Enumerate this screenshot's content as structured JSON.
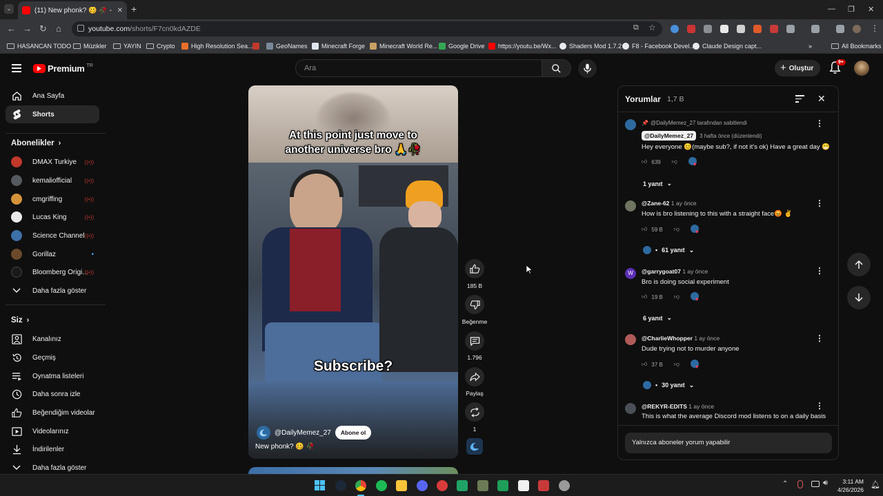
{
  "browser": {
    "tab_title": "(11) New phonk? 🥴 🥀 - YouTube",
    "url_host": "youtube.com",
    "url_path": "/shorts/F7cn0kdAZDE",
    "bookmarks": [
      "HASANCAN TODO",
      "Müzikler",
      "YAYIN",
      "Crypto",
      "High Resolution Sea...",
      "GeoNames",
      "Minecraft Forge",
      "Minecraft World Re...",
      "Google Drive",
      "https://youtu.be/Wx...",
      "Shaders Mod 1.7.2",
      "F8 - Facebook Devel...",
      "Claude Design capt..."
    ],
    "all_bookmarks": "All Bookmarks"
  },
  "header": {
    "logo": "Premium",
    "region": "TR",
    "search_placeholder": "Ara",
    "create_label": "Oluştur",
    "notif_badge": "9+"
  },
  "sidebar": {
    "main": [
      {
        "label": "Ana Sayfa",
        "icon": "home-icon"
      },
      {
        "label": "Shorts",
        "icon": "shorts-icon"
      }
    ],
    "subs_heading": "Abonelikler",
    "subs": [
      {
        "label": "DMAX Turkiye",
        "color": "#c0392b"
      },
      {
        "label": "kemaliofficial",
        "color": "#555a60"
      },
      {
        "label": "cmgriffing",
        "color": "#d4933a"
      },
      {
        "label": "Lucas King",
        "color": "#e9e9e9"
      },
      {
        "label": "Science Channel",
        "color": "#3d6fa8"
      },
      {
        "label": "Gorillaz",
        "color": "#6b4a2b"
      },
      {
        "label": "Bloomberg Origi...",
        "color": "#1a1a1a"
      }
    ],
    "subs_more": "Daha fazla göster",
    "you_heading": "Siz",
    "you": [
      {
        "label": "Kanalınız",
        "icon": "channel-icon"
      },
      {
        "label": "Geçmiş",
        "icon": "history-icon"
      },
      {
        "label": "Oynatma listeleri",
        "icon": "playlists-icon"
      },
      {
        "label": "Daha sonra izle",
        "icon": "watch-later-icon"
      },
      {
        "label": "Beğendiğim videolar",
        "icon": "liked-icon"
      },
      {
        "label": "Videolarınız",
        "icon": "your-videos-icon"
      },
      {
        "label": "İndirilenler",
        "icon": "downloads-icon"
      }
    ],
    "you_more": "Daha fazla göster"
  },
  "short": {
    "caption_top": "At this point just move to another universe bro 🙏🥀",
    "caption_mid": "Subscribe?",
    "channel": "@DailyMemez_27",
    "subscribe": "Abone ol",
    "title": "New phonk? 🥴 🥀",
    "likes": "185 B",
    "dislike_label": "Beğenme",
    "comments": "1.796",
    "share_label": "Paylaş",
    "remix": "1"
  },
  "comments": {
    "title": "Yorumlar",
    "count": "1,7 B",
    "pinned_by": "@DailyMemez_27 tarafından sabitlendi",
    "items": [
      {
        "author": "@DailyMemez_27",
        "time": "3 hafta önce (düzenlendi)",
        "text": "Hey everyone 😊(maybe sub?, if not it's ok) Have a great day 😁",
        "likes": "639",
        "replies": "1 yanıt",
        "avatar_color": "#2d6aa0"
      },
      {
        "author": "@Zane-62",
        "time": "1 ay önce",
        "text": "How is bro listening to this with a straight face😡 ✌️",
        "likes": "59 B",
        "replies": "61 yanıt",
        "avatar_color": "#6e7560"
      },
      {
        "author": "@garrygoat07",
        "time": "1 ay önce",
        "text": "Bro is doing social experiment",
        "likes": "19 B",
        "replies": "6 yanıt",
        "avatar_color": "#5b2fb5"
      },
      {
        "author": "@CharlieWhopper",
        "time": "1 ay önce",
        "text": "Dude trying not to murder anyone",
        "likes": "37 B",
        "replies": "30 yanıt",
        "avatar_color": "#b05a5a"
      },
      {
        "author": "@REKYR-EDITS",
        "time": "1 ay önce",
        "text": "This is what the average Discord mod listens to on a daily basis",
        "likes": "",
        "replies": "",
        "avatar_color": "#4a4f58"
      }
    ],
    "input_placeholder": "Yalnızca aboneler yorum yapabilir"
  },
  "taskbar": {
    "time": "3:11 AM",
    "date": "4/26/2026"
  }
}
